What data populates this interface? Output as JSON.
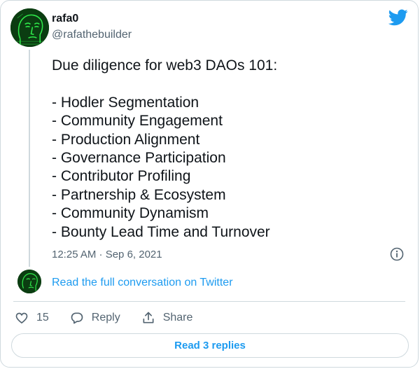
{
  "author": {
    "display_name": "rafa0",
    "username": "@rafathebuilder"
  },
  "icons": {
    "brand": "twitter-bird-icon",
    "info": "info-icon",
    "like": "heart-icon",
    "reply": "reply-bubble-icon",
    "share": "share-icon"
  },
  "tweet": {
    "heading": "Due diligence for web3 DAOs 101:",
    "items": [
      "- Hodler Segmentation",
      "- Community Engagement",
      "- Production Alignment",
      "- Governance Participation",
      "- Contributor Profiling",
      "- Partnership & Ecosystem",
      "- Community Dynamism",
      "- Bounty Lead Time and Turnover"
    ],
    "timestamp": "12:25 AM · Sep 6, 2021"
  },
  "conversation": {
    "link_label": "Read the full conversation on Twitter"
  },
  "actions": {
    "like_count": "15",
    "reply_label": "Reply",
    "share_label": "Share"
  },
  "replies": {
    "button_label": "Read 3 replies"
  },
  "colors": {
    "accent": "#1d9bf0",
    "text": "#0f1419",
    "muted": "#536471",
    "border": "#cfd9de",
    "avatar_bg": "#0b3d11",
    "avatar_fg": "#2ee84a"
  }
}
